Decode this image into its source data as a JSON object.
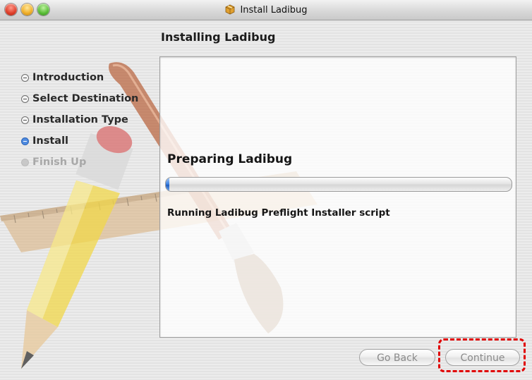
{
  "window": {
    "title": "Install Ladibug",
    "title_icon": "package-icon",
    "controls": [
      "close-button",
      "minimize-button",
      "zoom-button"
    ]
  },
  "page": {
    "heading": "Installing Ladibug"
  },
  "steps": [
    {
      "label": "Introduction",
      "state": "done"
    },
    {
      "label": "Select Destination",
      "state": "done"
    },
    {
      "label": "Installation Type",
      "state": "done"
    },
    {
      "label": "Install",
      "state": "active"
    },
    {
      "label": "Finish Up",
      "state": "future"
    }
  ],
  "progress": {
    "title": "Preparing Ladibug",
    "status": "Running Ladibug Preflight Installer script",
    "fraction": 0.01
  },
  "buttons": {
    "back_label": "Go Back",
    "continue_label": "Continue"
  },
  "colors": {
    "progress_blue": "#3a7fe0",
    "highlight_red": "#e00000",
    "active_step_blue": "#4f8be0"
  }
}
